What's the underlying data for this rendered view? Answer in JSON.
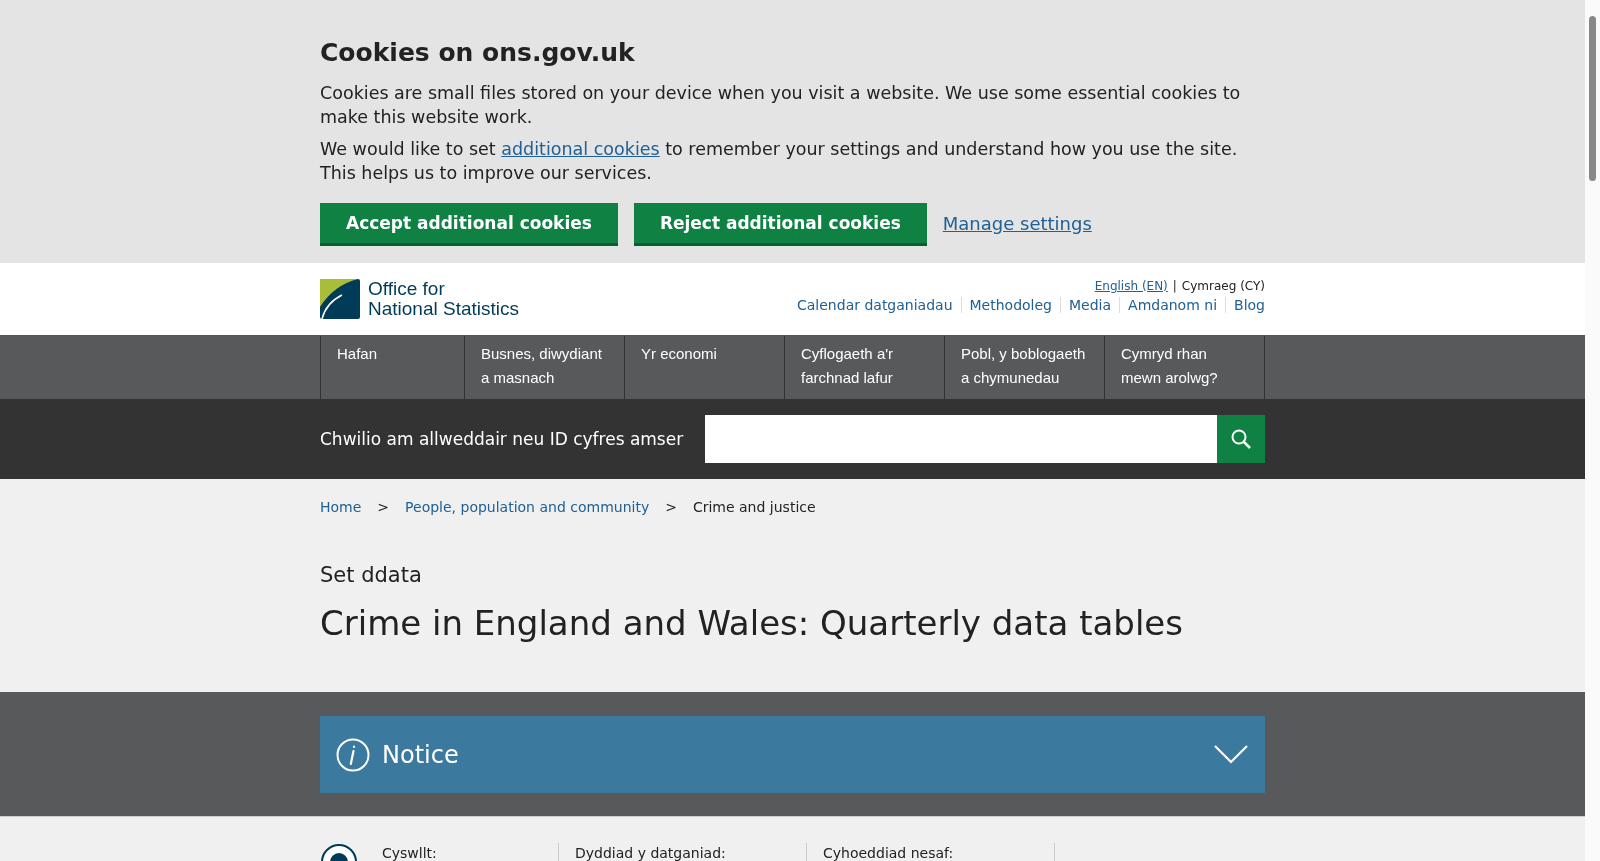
{
  "cookie_banner": {
    "title": "Cookies on ons.gov.uk",
    "paragraphs": [
      "Cookies are small files stored on your device when you visit a website. We use some essential cookies to make this website work."
    ],
    "second_paragraph": {
      "before": "We would like to set ",
      "link": "additional cookies",
      "after": " to remember your settings and understand how you use the site. This helps us to improve our services."
    },
    "buttons": [
      "Accept additional cookies",
      "Reject additional cookies"
    ],
    "settings_link": "Manage settings"
  },
  "header": {
    "logo_lines": [
      "Office for",
      "National Statistics"
    ],
    "languages": [
      {
        "label": "English (EN)",
        "selected": false
      },
      {
        "label": "Cymraeg (CY)",
        "selected": true
      }
    ],
    "language_separator": "|",
    "links": [
      "Calendar datganiadau",
      "Methodoleg",
      "Media",
      "Amdanom ni",
      "Blog"
    ]
  },
  "nav": {
    "items": [
      "Hafan",
      "Busnes, diwydiant a masnach",
      "Yr economi",
      "Cyflogaeth a'r farchnad lafur",
      "Pobl, y boblogaeth a chymunedau",
      "Cymryd rhan mewn arolwg?"
    ]
  },
  "search": {
    "label": "Chwilio am allweddair neu ID cyfres amser"
  },
  "breadcrumbs": [
    {
      "label": "Home",
      "kind": "link"
    },
    {
      "label": "People, population and community",
      "kind": "link"
    },
    {
      "label": "Crime and justice",
      "kind": "current"
    }
  ],
  "breadcrumb_separator": ">",
  "page": {
    "type_label": "Set ddata",
    "title": "Crime in England and Wales: Quarterly data tables"
  },
  "notice": {
    "title": "Notice",
    "expanded": false
  },
  "meta": [
    "Cyswllt:",
    "Dyddiad y datganiad:",
    "Cyhoeddiad nesaf:"
  ]
}
